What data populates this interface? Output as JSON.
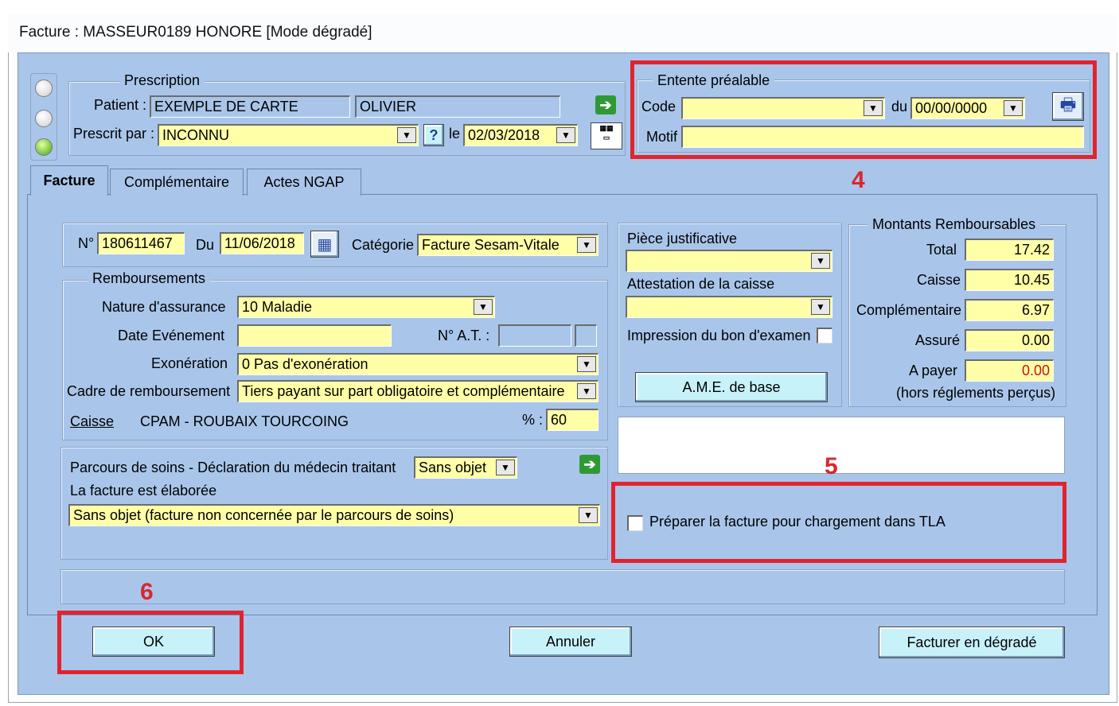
{
  "window": {
    "title": "Facture : MASSEUR0189 HONORE [Mode dégradé]"
  },
  "prescription": {
    "legend": "Prescription",
    "patient_label": "Patient :",
    "patient_last": "EXEMPLE DE CARTE",
    "patient_first": "OLIVIER",
    "prescrit_label": "Prescrit par :",
    "prescrit_value": "INCONNU",
    "help_label": "?",
    "le_label": "le",
    "date": "02/03/2018"
  },
  "entente": {
    "legend": "Entente préalable",
    "code_label": "Code",
    "code_value": "",
    "du_label": "du",
    "du_value": "00/00/0000",
    "motif_label": "Motif",
    "motif_value": ""
  },
  "tabs": [
    {
      "label": "Facture",
      "active": true
    },
    {
      "label": "Complémentaire",
      "active": false
    },
    {
      "label": "Actes NGAP",
      "active": false
    }
  ],
  "facture": {
    "num_label": "N°",
    "num_value": "180611467",
    "du_label": "Du",
    "du_value": "11/06/2018",
    "categorie_label": "Catégorie",
    "categorie_value": "Facture Sesam-Vitale"
  },
  "remboursements": {
    "legend": "Remboursements",
    "nature_label": "Nature d'assurance",
    "nature_value": "10  Maladie",
    "date_evt_label": "Date Evénement",
    "date_evt_value": "",
    "nat_label": "N° A.T. :",
    "exo_label": "Exonération",
    "exo_value": "0  Pas d'exonération",
    "cadre_label": "Cadre de remboursement",
    "cadre_value": "Tiers payant sur part obligatoire et complémentaire",
    "caisse_link": "Caisse",
    "caisse_name": "CPAM - ROUBAIX TOURCOING",
    "pct_label": "% :",
    "pct_value": "60"
  },
  "parcours": {
    "label": "Parcours de soins - Déclaration du médecin traitant",
    "value": "Sans objet",
    "elaboree_label": "La facture est élaborée",
    "elaboree_value": "Sans objet (facture non concernée par le parcours de soins)"
  },
  "piece": {
    "piece_label": "Pièce justificative",
    "attestation_label": "Attestation de la caisse",
    "impression_label": "Impression du bon d'examen",
    "ame_button": "A.M.E. de base"
  },
  "montants": {
    "legend": "Montants Remboursables",
    "total_label": "Total",
    "total_value": "17.42",
    "caisse_label": "Caisse",
    "caisse_value": "10.45",
    "comp_label": "Complémentaire",
    "comp_value": "6.97",
    "assure_label": "Assuré",
    "assure_value": "0.00",
    "apayer_label": "A payer",
    "apayer_value": "0.00",
    "hors_label": "(hors réglements perçus)"
  },
  "tla": {
    "label": "Préparer la facture pour chargement dans TLA"
  },
  "buttons": {
    "ok": "OK",
    "annuler": "Annuler",
    "degrade": "Facturer en dégradé"
  },
  "annotations": {
    "n4": "4",
    "n5": "5",
    "n6": "6"
  },
  "colors": {
    "client_bg": "#a9c6ea",
    "field_bg": "#ffffa8",
    "button_bg": "#c8f2fa",
    "annotation_red": "#e2232f"
  }
}
